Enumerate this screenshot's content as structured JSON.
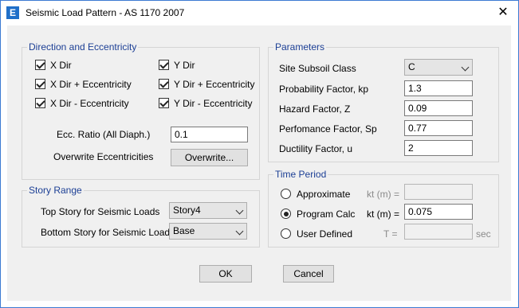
{
  "window": {
    "title": "Seismic Load Pattern - AS 1170 2007",
    "app_icon": "E",
    "close": "✕"
  },
  "direction": {
    "legend": "Direction and Eccentricity",
    "checks": [
      {
        "label": "X Dir",
        "checked": true
      },
      {
        "label": "Y Dir",
        "checked": true
      },
      {
        "label": "X Dir + Eccentricity",
        "checked": true
      },
      {
        "label": "Y Dir + Eccentricity",
        "checked": true
      },
      {
        "label": "X Dir - Eccentricity",
        "checked": true
      },
      {
        "label": "Y Dir - Eccentricity",
        "checked": true
      }
    ],
    "ecc_label": "Ecc. Ratio (All Diaph.)",
    "ecc_value": "0.1",
    "overwrite_label": "Overwrite Eccentricities",
    "overwrite_button": "Overwrite..."
  },
  "story": {
    "legend": "Story Range",
    "top_label": "Top Story for Seismic Loads",
    "top_value": "Story4",
    "bottom_label": "Bottom Story for Seismic Loads",
    "bottom_value": "Base"
  },
  "parameters": {
    "legend": "Parameters",
    "site_label": "Site Subsoil Class",
    "site_value": "C",
    "prob_label": "Probability Factor, kp",
    "prob_value": "1.3",
    "hazard_label": "Hazard Factor, Z",
    "hazard_value": "0.09",
    "perf_label": "Perfomance Factor, Sp",
    "perf_value": "0.77",
    "duct_label": "Ductility Factor, u",
    "duct_value": "2"
  },
  "period": {
    "legend": "Time Period",
    "approx_label": "Approximate",
    "approx_kt": "kt (m) =",
    "program_label": "Program Calc",
    "program_kt": "kt (m) =",
    "program_value": "0.075",
    "user_label": "User Defined",
    "user_t": "T =",
    "user_unit": "sec",
    "selected": "Program Calc"
  },
  "buttons": {
    "ok": "OK",
    "cancel": "Cancel"
  }
}
